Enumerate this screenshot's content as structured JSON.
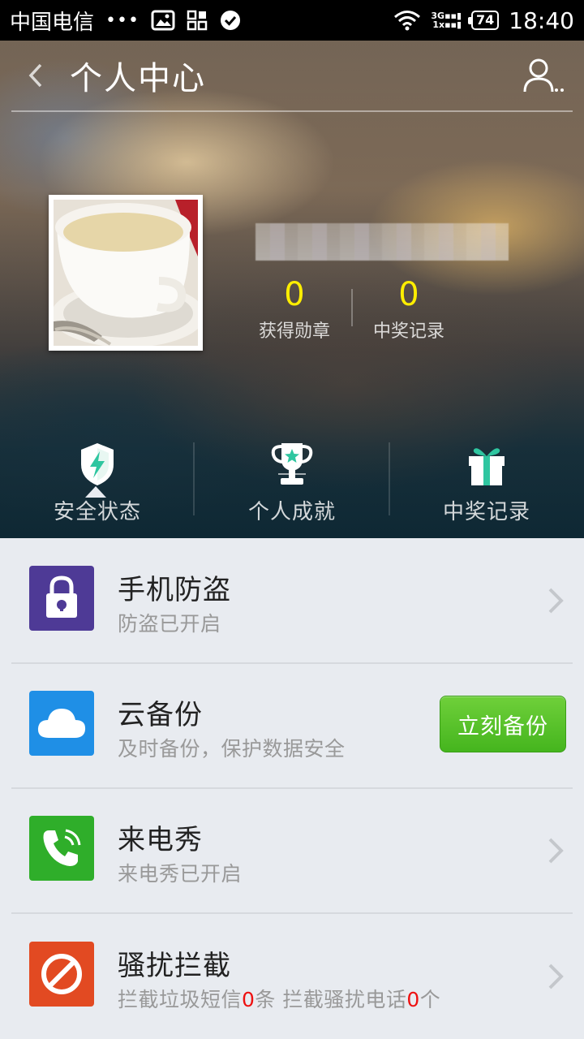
{
  "status_bar": {
    "carrier": "中国电信",
    "dots": "•••",
    "network_top": "3G",
    "network_bottom": "1x",
    "battery": "74",
    "time": "18:40"
  },
  "header": {
    "title": "个人中心"
  },
  "profile": {
    "stats": [
      {
        "value": "0",
        "label": "获得勋章"
      },
      {
        "value": "0",
        "label": "中奖记录"
      }
    ]
  },
  "tabs": [
    {
      "label": "安全状态",
      "icon": "shield-bolt-icon",
      "color": "#2fc6a0"
    },
    {
      "label": "个人成就",
      "icon": "trophy-icon",
      "color": "#2fc6a0"
    },
    {
      "label": "中奖记录",
      "icon": "gift-icon",
      "color": "#2fc6a0"
    }
  ],
  "list": [
    {
      "title": "手机防盗",
      "subtitle": "防盗已开启",
      "icon": "lock-icon",
      "color": "#4e3a96"
    },
    {
      "title": "云备份",
      "subtitle": "及时备份，保护数据安全",
      "icon": "cloud-icon",
      "color": "#1f8fe6",
      "button": "立刻备份"
    },
    {
      "title": "来电秀",
      "subtitle": "来电秀已开启",
      "icon": "phone-icon",
      "color": "#2fae2a"
    },
    {
      "title": "骚扰拦截",
      "subtitle_parts": [
        "拦截垃圾短信",
        "0",
        "条 拦截骚扰电话",
        "0",
        "个"
      ],
      "icon": "block-icon",
      "color": "#e24a22"
    }
  ]
}
